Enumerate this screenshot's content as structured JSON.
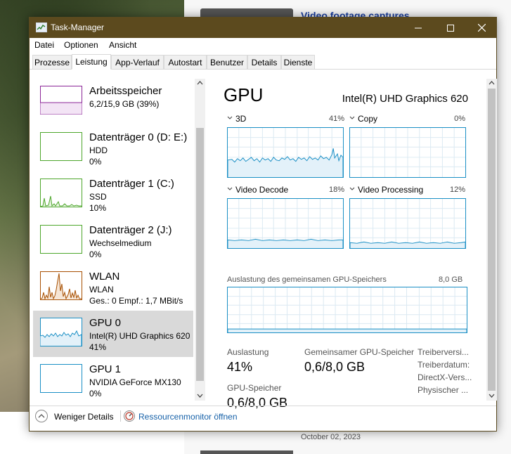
{
  "background": {
    "article_title": "Video footage captures",
    "article_date": "October 02, 2023"
  },
  "window": {
    "title": "Task-Manager",
    "menu": [
      "Datei",
      "Optionen",
      "Ansicht"
    ],
    "tabs": [
      "Prozesse",
      "Leistung",
      "App-Verlauf",
      "Autostart",
      "Benutzer",
      "Details",
      "Dienste"
    ],
    "active_tab": "Leistung"
  },
  "resources": [
    {
      "name": "Arbeitsspeicher",
      "sub1": "6,2/15,9 GB (39%)",
      "sub2": "",
      "color": "#8b2597",
      "selected": false
    },
    {
      "name": "Datenträger 0 (D: E:)",
      "sub1": "HDD",
      "sub2": "0%",
      "color": "#4da62b",
      "selected": false
    },
    {
      "name": "Datenträger 1 (C:)",
      "sub1": "SSD",
      "sub2": "10%",
      "color": "#4da62b",
      "selected": false
    },
    {
      "name": "Datenträger 2 (J:)",
      "sub1": "Wechselmedium",
      "sub2": "0%",
      "color": "#4da62b",
      "selected": false
    },
    {
      "name": "WLAN",
      "sub1": "WLAN",
      "sub2": "Ges.: 0 Empf.: 1,7 MBit/s",
      "color": "#a74f01",
      "selected": false
    },
    {
      "name": "GPU 0",
      "sub1": "Intel(R) UHD Graphics 620",
      "sub2": "41%",
      "color": "#1a8fc5",
      "selected": true
    },
    {
      "name": "GPU 1",
      "sub1": "NVIDIA GeForce MX130",
      "sub2": "0%",
      "color": "#1a8fc5",
      "selected": false
    }
  ],
  "detail": {
    "title": "GPU",
    "model": "Intel(R) UHD Graphics 620",
    "engines": [
      {
        "label": "3D",
        "percent": "41%"
      },
      {
        "label": "Copy",
        "percent": "0%"
      },
      {
        "label": "Video Decode",
        "percent": "18%"
      },
      {
        "label": "Video Processing",
        "percent": "12%"
      }
    ],
    "shared_memory_label": "Auslastung des gemeinsamen GPU-Speichers",
    "shared_memory_max": "8,0 GB",
    "stats": {
      "utilization_label": "Auslastung",
      "utilization_value": "41%",
      "shared_label": "Gemeinsamer GPU-Speicher",
      "shared_value": "0,6/8,0 GB",
      "gpu_mem_label": "GPU-Speicher",
      "gpu_mem_value": "0,6/8,0 GB",
      "driver_lines": [
        "Treiberversi...",
        "Treiberdatum:",
        "DirectX-Vers...",
        "Physischer ..."
      ]
    }
  },
  "bottom": {
    "less_details": "Weniger Details",
    "resource_monitor": "Ressourcenmonitor öffnen"
  },
  "colors": {
    "titlebar": "#5c4a1e",
    "graph_border": "#1a8fc5",
    "link": "#1560a8",
    "selected_row": "#d9d9d9"
  }
}
